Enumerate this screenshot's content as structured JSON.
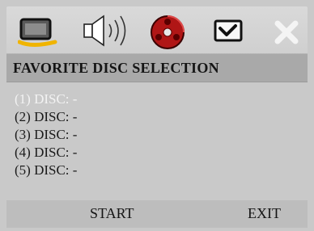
{
  "header": {
    "title": "FAVORITE DISC SELECTION"
  },
  "icons": [
    {
      "name": "display-icon",
      "active": true
    },
    {
      "name": "speaker-icon",
      "active": false
    },
    {
      "name": "reel-icon",
      "active": false
    },
    {
      "name": "checkbox-icon",
      "active": false
    },
    {
      "name": "close-icon",
      "active": false
    }
  ],
  "discs": [
    {
      "label": "(1) DISC: -",
      "selected": true
    },
    {
      "label": "(2) DISC: -",
      "selected": false
    },
    {
      "label": "(3) DISC: -",
      "selected": false
    },
    {
      "label": "(4) DISC: -",
      "selected": false
    },
    {
      "label": "(5) DISC: -",
      "selected": false
    }
  ],
  "footer": {
    "start_label": "START",
    "exit_label": "EXIT"
  },
  "colors": {
    "background": "#c9c9c9",
    "header_bg": "#a9a9a9",
    "selected_text": "#f3f3f3",
    "active_icon_underline": "#f0b400",
    "reel_red": "#b01616"
  }
}
